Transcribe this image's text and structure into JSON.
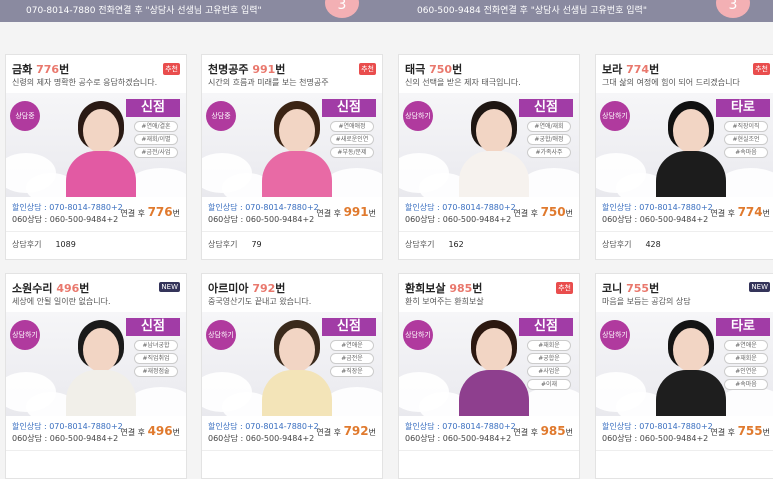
{
  "top": {
    "left_text": "070-8014-7880 전화연결 후 \"상담사 선생님 고유번호 입력\"",
    "right_text": "060-500-9484 전화연결 후 \"상담사 선생님 고유번호 입력\"",
    "left_circle": "3",
    "right_circle": "3"
  },
  "counselors": [
    {
      "name": "금화",
      "number": "776",
      "suffix": "번",
      "badge": "추천",
      "badge_type": "rec",
      "desc": "신령의 제자 명확한 공수로 응답하겠습니다.",
      "status": "상담중",
      "category": "신점",
      "tags": [
        "#연애/결혼",
        "#재회/이별",
        "#금전/사업"
      ],
      "line1": "할인상담 : 070-8014-7880+2",
      "line2": "060상담 : 060-500-9484+2",
      "price_label": "연결 후",
      "price": "776",
      "price_unit": "번",
      "review_label": "상담후기",
      "reviews": "1089",
      "hair": "#2a1a14",
      "body": "#e25aa3"
    },
    {
      "name": "천명공주",
      "number": "991",
      "suffix": "번",
      "badge": "추천",
      "badge_type": "rec",
      "desc": "시간의 흐름과 미래를 보는 천명공주",
      "status": "상담중",
      "category": "신점",
      "tags": [
        "#연애애정",
        "#새로운인연",
        "#부동/문제"
      ],
      "line1": "할인상담 : 070-8014-7880+2",
      "line2": "060상담 : 060-500-9484+2",
      "price_label": "연결 후",
      "price": "991",
      "price_unit": "번",
      "review_label": "상담후기",
      "reviews": "79",
      "hair": "#3b2414",
      "body": "#e86aa5"
    },
    {
      "name": "태극",
      "number": "750",
      "suffix": "번",
      "badge": "",
      "badge_type": "",
      "desc": "신의 선택을 받은 제자 태극입니다.",
      "status": "상담하기",
      "category": "신점",
      "tags": [
        "#연애/재회",
        "#궁합/애정",
        "#가족사주"
      ],
      "line1": "할인상담 : 070-8014-7880+2",
      "line2": "060상담 : 060-500-9484+2",
      "price_label": "연결 후",
      "price": "750",
      "price_unit": "번",
      "review_label": "상담후기",
      "reviews": "162",
      "hair": "#1e1612",
      "body": "#f6f2ee"
    },
    {
      "name": "보라",
      "number": "774",
      "suffix": "번",
      "badge": "추천",
      "badge_type": "rec",
      "desc": "그대 삶의 여정에 힘이 되어 드리겠습니다",
      "status": "상담하기",
      "category": "타로",
      "tags": [
        "#직장이직",
        "#현실조언",
        "#속마음"
      ],
      "line1": "할인상담 : 070-8014-7880+2",
      "line2": "060상담 : 060-500-9484+2",
      "price_label": "연결 후",
      "price": "774",
      "price_unit": "번",
      "review_label": "상담후기",
      "reviews": "428",
      "hair": "#111111",
      "body": "#1c1c1c"
    },
    {
      "name": "소원수리",
      "number": "496",
      "suffix": "번",
      "badge": "NEW",
      "badge_type": "new",
      "desc": "세상에 안될 일이란 없습니다.",
      "status": "상담하기",
      "category": "신점",
      "tags": [
        "#남녀궁합",
        "#직업취업",
        "#재정점술"
      ],
      "line1": "할인상담 : 070-8014-7880+2",
      "line2": "060상담 : 060-500-9484+2",
      "price_label": "연결 후",
      "price": "496",
      "price_unit": "번",
      "review_label": "",
      "reviews": "",
      "hair": "#1a1a1a",
      "body": "#f1efe9"
    },
    {
      "name": "아르미아",
      "number": "792",
      "suffix": "번",
      "badge": "",
      "badge_type": "",
      "desc": "중국영산기도 끝내고 왔습니다.",
      "status": "상담하기",
      "category": "신점",
      "tags": [
        "#연애운",
        "#금전운",
        "#직장운"
      ],
      "line1": "할인상담 : 070-8014-7880+2",
      "line2": "060상담 : 060-500-9484+2",
      "price_label": "연결 후",
      "price": "792",
      "price_unit": "번",
      "review_label": "",
      "reviews": "",
      "hair": "#3a2a1c",
      "body": "#f3e4b8"
    },
    {
      "name": "환희보살",
      "number": "985",
      "suffix": "번",
      "badge": "추천",
      "badge_type": "rec",
      "desc": "환히 보여주는 환희보살",
      "status": "상담하기",
      "category": "신점",
      "tags": [
        "#재회운",
        "#궁합운",
        "#사업운",
        "#이재"
      ],
      "line1": "할인상담 : 070-8014-7880+2",
      "line2": "060상담 : 060-500-9484+2",
      "price_label": "연결 후",
      "price": "985",
      "price_unit": "번",
      "review_label": "",
      "reviews": "",
      "hair": "#2c1810",
      "body": "#8e3f8e"
    },
    {
      "name": "코니",
      "number": "755",
      "suffix": "번",
      "badge": "NEW",
      "badge_type": "new",
      "desc": "마음을 보듬는 공감의 상담",
      "status": "상담하기",
      "category": "타로",
      "tags": [
        "#연애운",
        "#재회운",
        "#인연운",
        "#속마음"
      ],
      "line1": "할인상담 : 070-8014-7880+2",
      "line2": "060상담 : 060-500-9484+2",
      "price_label": "연결 후",
      "price": "755",
      "price_unit": "번",
      "review_label": "",
      "reviews": "",
      "hair": "#141414",
      "body": "#1e1e1e"
    }
  ]
}
